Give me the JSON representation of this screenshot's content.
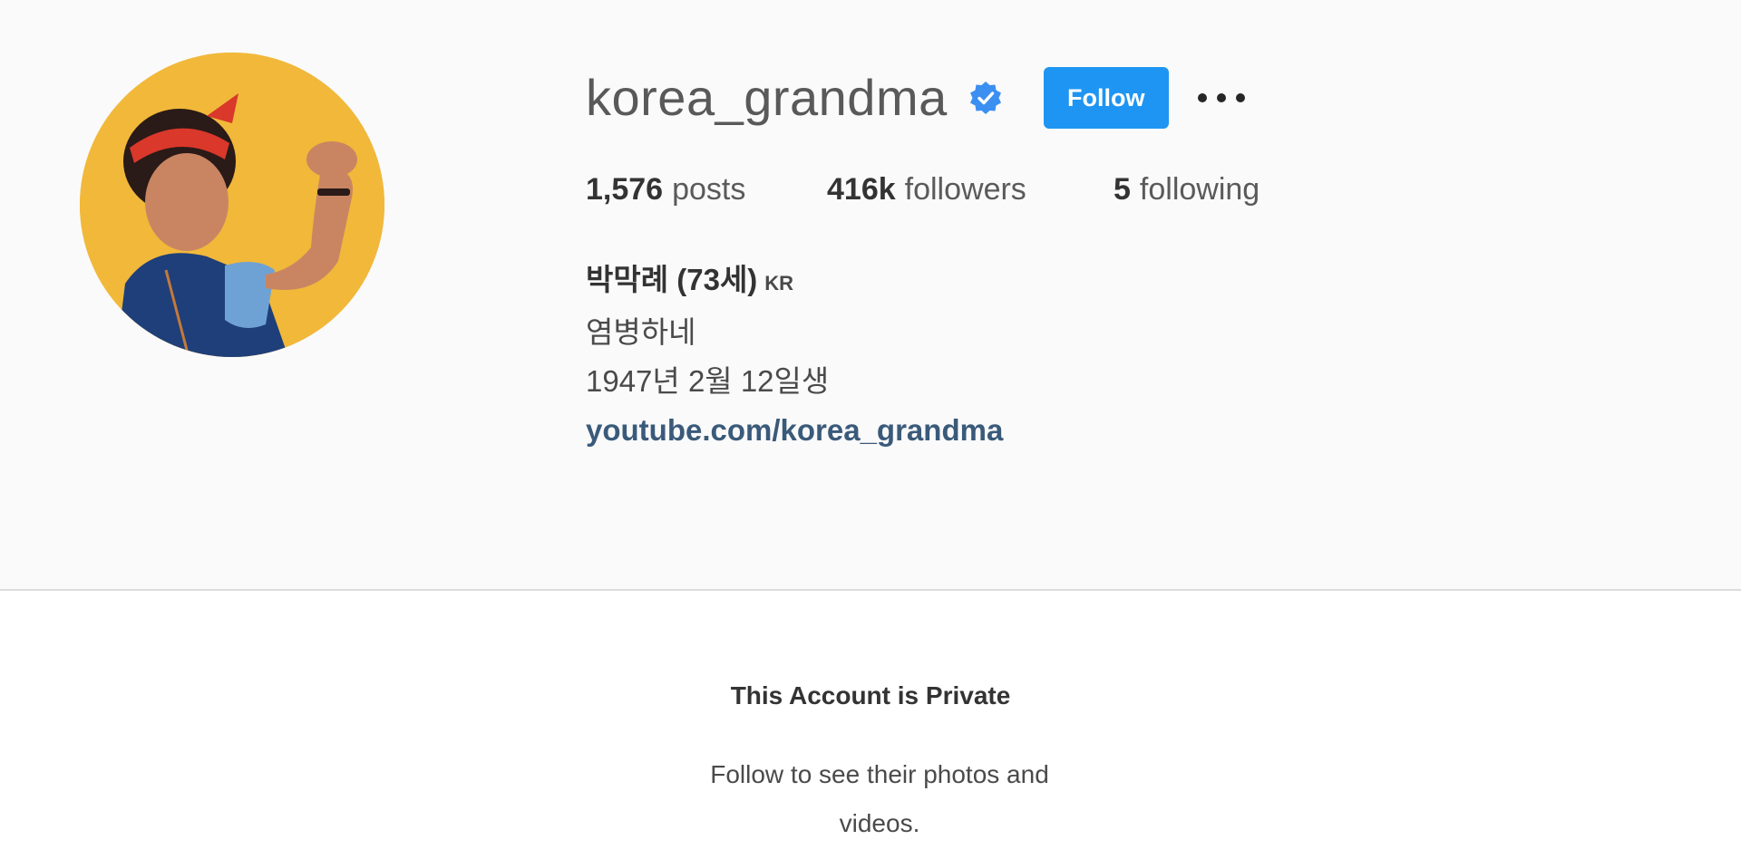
{
  "profile": {
    "username": "korea_grandma",
    "verified": true,
    "follow_label": "Follow",
    "more_icon": "more-horizontal-icon",
    "avatar_icon": "profile-photo",
    "stats": {
      "posts_count": "1,576",
      "posts_label": "posts",
      "followers_count": "416k",
      "followers_label": "followers",
      "following_count": "5",
      "following_label": "following"
    },
    "bio": {
      "name": "박막례 (73세)",
      "country": "KR",
      "line1": "염병하네",
      "line2": "1947년 2월 12일생",
      "link": "youtube.com/korea_grandma"
    }
  },
  "private": {
    "title": "This Account is Private",
    "text": "Follow to see their photos and videos."
  },
  "colors": {
    "accent": "#1e95f2",
    "verified": "#3b8ff0",
    "background": "#fafafa"
  }
}
